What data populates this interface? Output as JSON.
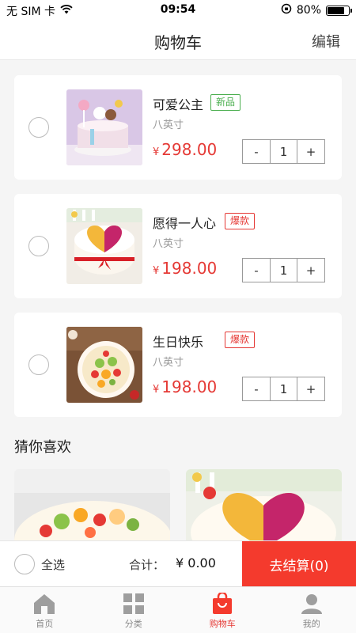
{
  "status": {
    "carrier": "无 SIM 卡",
    "time": "09:54",
    "battery": "80%",
    "battery_level": 0.8
  },
  "nav": {
    "title": "购物车",
    "edit": "编辑"
  },
  "cart_items": [
    {
      "name": "可爱公主",
      "tag": "新品",
      "spec": "八英寸",
      "currency": "¥",
      "price": "298.00",
      "minus": "-",
      "qty": "1",
      "plus": "+"
    },
    {
      "name": "愿得一人心",
      "tag": "爆款",
      "spec": "八英寸",
      "currency": "¥",
      "price": "198.00",
      "minus": "-",
      "qty": "1",
      "plus": "+"
    },
    {
      "name": "生日快乐",
      "tag": "爆款",
      "spec": "八英寸",
      "currency": "¥",
      "price": "198.00",
      "minus": "-",
      "qty": "1",
      "plus": "+"
    }
  ],
  "recommend": {
    "title": "猜你喜欢"
  },
  "bottom": {
    "select_all": "全选",
    "total_label": "合计：",
    "total_value": "¥ 0.00",
    "checkout": "去结算(0)"
  },
  "tabs": [
    {
      "label": "首页"
    },
    {
      "label": "分类"
    },
    {
      "label": "购物车"
    },
    {
      "label": "我的"
    }
  ],
  "colors": {
    "accent": "#f43a2d",
    "tag_new": "#4caf50",
    "tag_hot": "#e53935"
  }
}
